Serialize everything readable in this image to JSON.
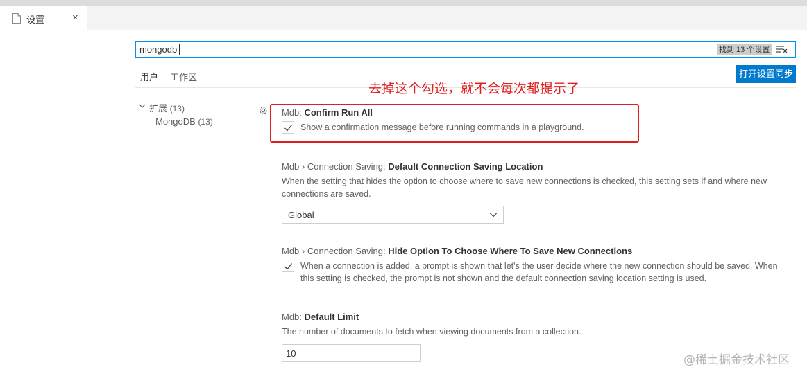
{
  "tab": {
    "label": "设置",
    "close": "×"
  },
  "search": {
    "value": "mongodb",
    "result_count": "找到 13 个设置"
  },
  "scope_tabs": [
    {
      "label": "用户"
    },
    {
      "label": "工作区"
    }
  ],
  "sync_button": {
    "label": "打开设置同步"
  },
  "annotation": "去掉这个勾选，就不会每次都提示了",
  "toc": {
    "group": {
      "label": "扩展",
      "count": "(13)"
    },
    "child": {
      "label": "MongoDB",
      "count": "(13)"
    }
  },
  "settings": [
    {
      "prefix": "Mdb: ",
      "name": "Confirm Run All",
      "description": "Show a confirmation message before running commands in a playground.",
      "checked": true
    },
    {
      "prefix": "Mdb › Connection Saving: ",
      "name": "Default Connection Saving Location",
      "description": "When the setting that hides the option to choose where to save new connections is checked, this setting sets if and where new connections are saved.",
      "select_value": "Global"
    },
    {
      "prefix": "Mdb › Connection Saving: ",
      "name": "Hide Option To Choose Where To Save New Connections",
      "description": "When a connection is added, a prompt is shown that let's the user decide where the new connection should be saved. When this setting is checked, the prompt is not shown and the default connection saving location setting is used.",
      "checked": true
    },
    {
      "prefix": "Mdb: ",
      "name": "Default Limit",
      "description": "The number of documents to fetch when viewing documents from a collection.",
      "value": "10"
    }
  ],
  "watermark": "@稀土掘金技术社区",
  "colors": {
    "accent": "#007acc",
    "focus_border": "#0090f1",
    "annotation": "#e02020"
  },
  "icons": [
    "file-icon",
    "close-icon",
    "clear-filter-icon",
    "chevron-down-icon",
    "gear-icon",
    "check-icon"
  ]
}
